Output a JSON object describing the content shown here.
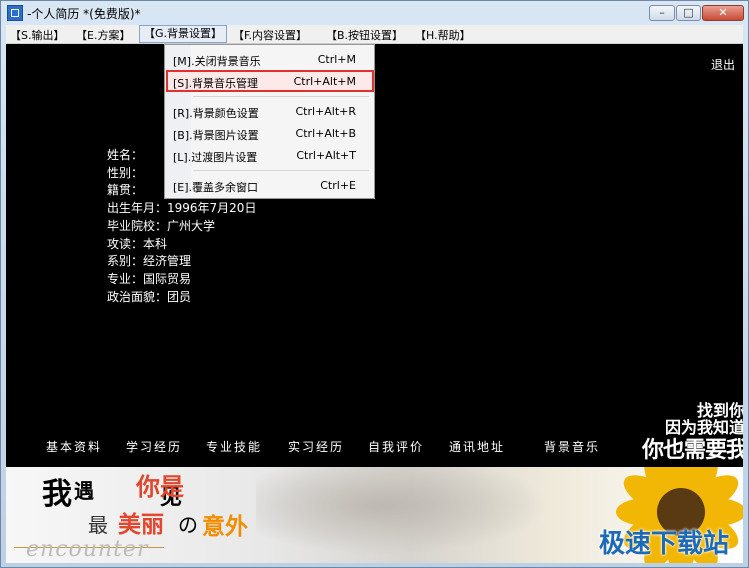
{
  "window": {
    "title": "-个人简历 *(免费版)*",
    "controls": {
      "min": "▭",
      "max": "□",
      "close": "✕"
    }
  },
  "menubar": [
    "【S.输出】",
    "【E.方案】",
    "【G.背景设置】",
    "【F.内容设置】",
    "【B.按钮设置】",
    "【H.帮助】"
  ],
  "dropdown": {
    "items": [
      {
        "label": "[M].关闭背景音乐",
        "shortcut": "Ctrl+M"
      },
      {
        "label": "[S].背景音乐管理",
        "shortcut": "Ctrl+Alt+M"
      },
      {
        "label": "[R].背景颜色设置",
        "shortcut": "Ctrl+Alt+R"
      },
      {
        "label": "[B].背景图片设置",
        "shortcut": "Ctrl+Alt+B"
      },
      {
        "label": "[L].过渡图片设置",
        "shortcut": "Ctrl+Alt+T"
      },
      {
        "label": "[E].覆盖多余窗口",
        "shortcut": "Ctrl+E"
      }
    ]
  },
  "content": {
    "exit": "退出",
    "profile": [
      "姓名：",
      "性别：",
      "籍贯：",
      "出生年月：1996年7月20日",
      "毕业院校：广州大学",
      "攻读：本科",
      "系别：经济管理",
      "专业：国际贸易",
      "政治面貌：团员"
    ],
    "nav": [
      "基本资料",
      "学习经历",
      "专业技能",
      "实习经历",
      "自我评价",
      "通讯地址",
      "背景音乐"
    ],
    "slogan": [
      "找到你",
      "因为我知道",
      "你也需要我"
    ]
  },
  "banner": {
    "texts": [
      "我",
      "遇",
      "见",
      "你是",
      "最",
      "美丽",
      "の",
      "意外",
      "encounter"
    ],
    "watermark": "极速下载站"
  },
  "colors": {
    "accent_red": "#e03030",
    "banner_red": "#e2472e",
    "banner_orange": "#f08e00",
    "watermark_blue": "#1d6bb8"
  }
}
